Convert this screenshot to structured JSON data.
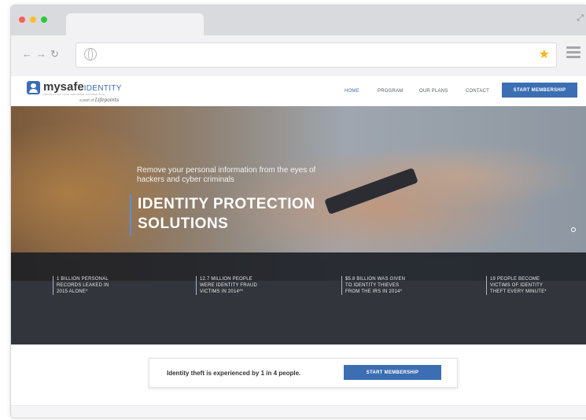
{
  "browser": {
    "traffic_lights": [
      "#ff5f57",
      "#ffbd2e",
      "#28c840"
    ],
    "star_color": "#f5b51a"
  },
  "site": {
    "brand": {
      "name_my": "mysafe",
      "name_identity": "IDENTITY",
      "tagline": "PROTECTING YOUR PERSONAL INFORMATION",
      "part_of": "a part of",
      "parent": "Lifepoints"
    },
    "nav": [
      {
        "label": "HOME",
        "active": true
      },
      {
        "label": "PROGRAM"
      },
      {
        "label": "OUR PLANS"
      },
      {
        "label": "CONTACT"
      }
    ],
    "header_cta": "START MEMBERSHIP",
    "hero": {
      "subtitle": "Remove your personal information from the eyes of hackers and cyber criminals",
      "title_line1": "IDENTITY PROTECTION",
      "title_line2": "SOLUTIONS"
    },
    "stats": [
      "1 BILLION PERSONAL\nRECORDS LEAKED IN\n2015 ALONE*",
      "12.7 MILLION PEOPLE\nWERE IDENTITY FRAUD\nVICTIMS IN 2014**",
      "$5.8 BILLION WAS GIVEN\nTO IDENTITY THIEVES\nFROM THE IRS IN 2014*",
      "19 PEOPLE BECOME\nVICTIMS OF IDENTITY\nTHEFT EVERY MINUTE*"
    ],
    "cta_bar": {
      "text": "Identity theft is experienced by 1 in 4 people.",
      "button": "START MEMBERSHIP"
    },
    "accent_color": "#3b6eb3"
  }
}
